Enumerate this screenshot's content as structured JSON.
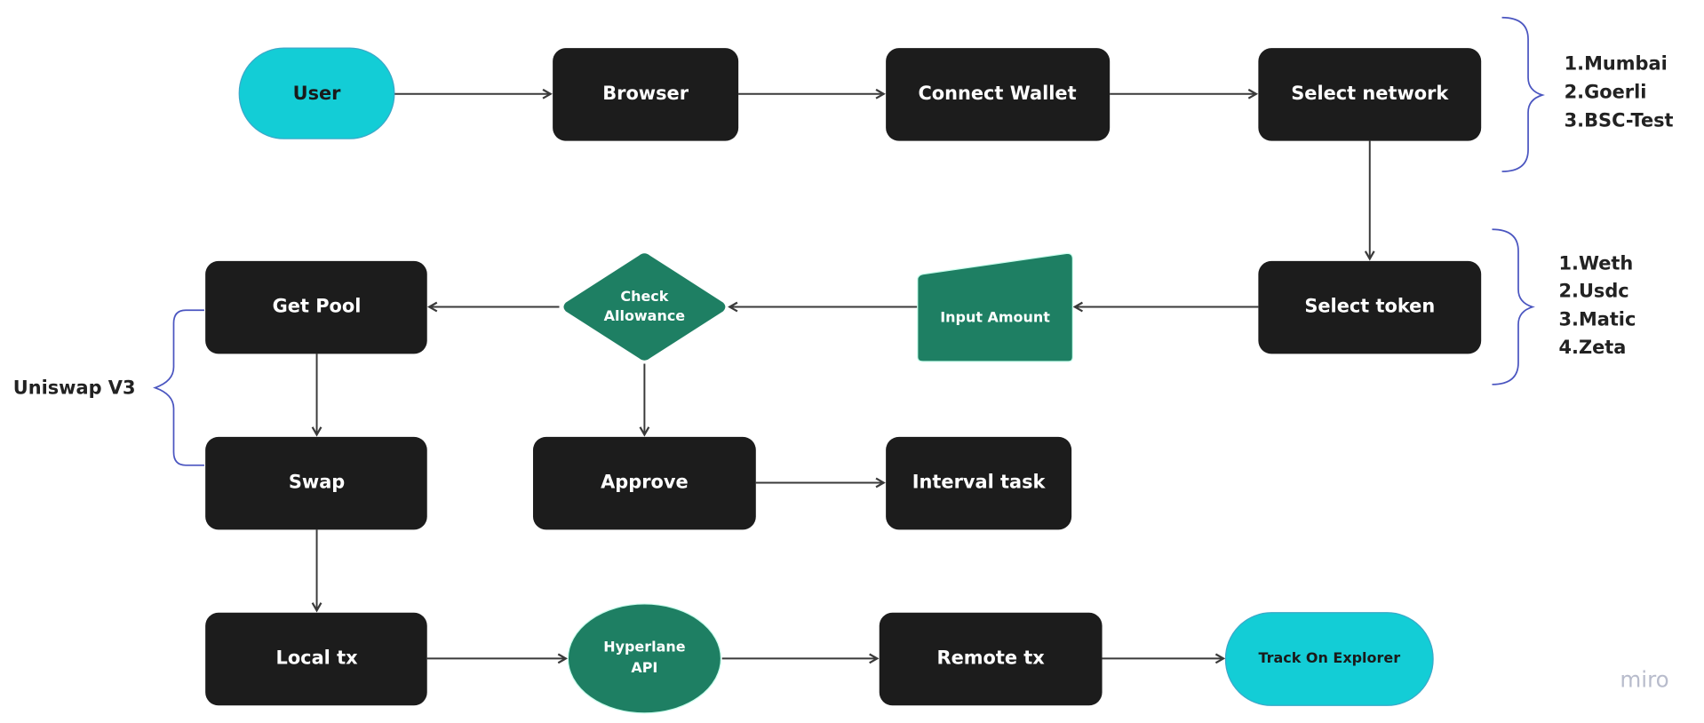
{
  "colors": {
    "terminal": "#13CDD6",
    "process": "#1c1c1c",
    "green": "#1e7f63",
    "brace": "#4a55c0"
  },
  "nodes": {
    "user": "User",
    "browser": "Browser",
    "connect_wallet": "Connect Wallet",
    "select_network": "Select network",
    "select_token": "Select token",
    "input_amount": "Input Amount",
    "check_allowance_1": "Check",
    "check_allowance_2": "Allowance",
    "get_pool": "Get Pool",
    "swap": "Swap",
    "approve": "Approve",
    "interval_task": "Interval task",
    "local_tx": "Local tx",
    "hyperlane_1": "Hyperlane",
    "hyperlane_2": "API",
    "remote_tx": "Remote tx",
    "track": "Track On Explorer"
  },
  "networks": [
    "1.Mumbai",
    "2.Goerli",
    "3.BSC-Test"
  ],
  "tokens": [
    "1.Weth",
    "2.Usdc",
    "3.Matic",
    "4.Zeta"
  ],
  "uniswap_label": "Uniswap V3",
  "watermark": "miro"
}
